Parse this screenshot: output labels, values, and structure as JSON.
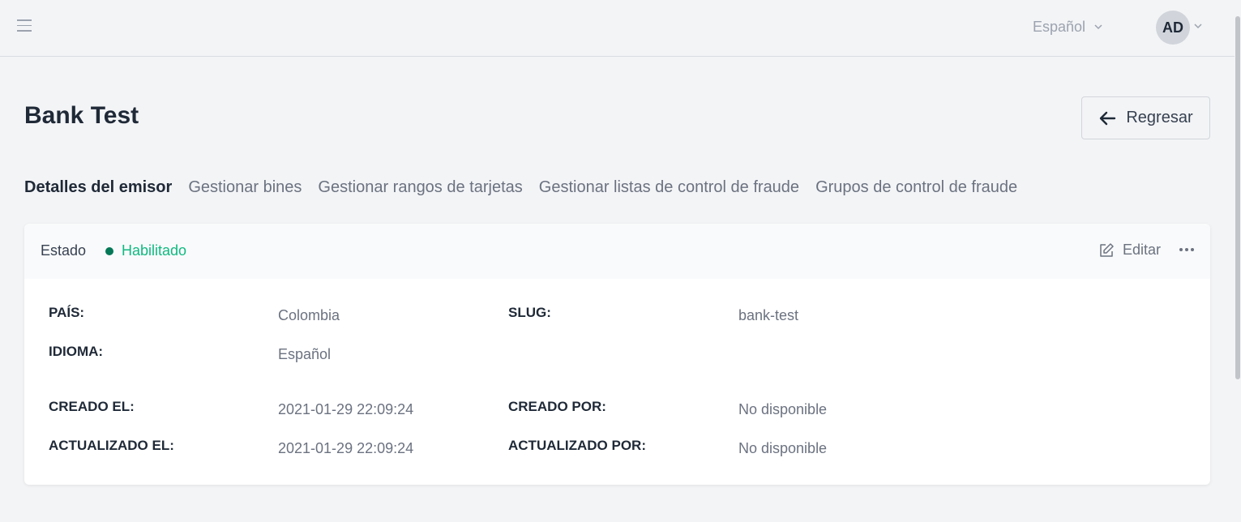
{
  "header": {
    "language": "Español",
    "user_initials": "AD"
  },
  "page": {
    "title": "Bank Test",
    "back_label": "Regresar"
  },
  "tabs": [
    {
      "label": "Detalles del emisor",
      "active": true
    },
    {
      "label": "Gestionar bines",
      "active": false
    },
    {
      "label": "Gestionar rangos de tarjetas",
      "active": false
    },
    {
      "label": "Gestionar listas de control de fraude",
      "active": false
    },
    {
      "label": "Grupos de control de fraude",
      "active": false
    }
  ],
  "card": {
    "status_label": "Estado",
    "status_value": "Habilitado",
    "status_color": "#10b981",
    "edit_label": "Editar",
    "fields": {
      "country_label": "PAÍS:",
      "country_value": "Colombia",
      "slug_label": "SLUG:",
      "slug_value": "bank-test",
      "language_label": "IDIOMA:",
      "language_value": "Español",
      "created_at_label": "CREADO EL:",
      "created_at_value": "2021-01-29 22:09:24",
      "created_by_label": "CREADO POR:",
      "created_by_value": "No disponible",
      "updated_at_label": "ACTUALIZADO EL:",
      "updated_at_value": "2021-01-29 22:09:24",
      "updated_by_label": "ACTUALIZADO POR:",
      "updated_by_value": "No disponible"
    }
  },
  "icons": {
    "menu": "hamburger-icon",
    "lang_chevron": "chevron-down-icon",
    "back": "arrow-left-icon",
    "edit": "edit-icon",
    "more": "more-horizontal-icon"
  }
}
